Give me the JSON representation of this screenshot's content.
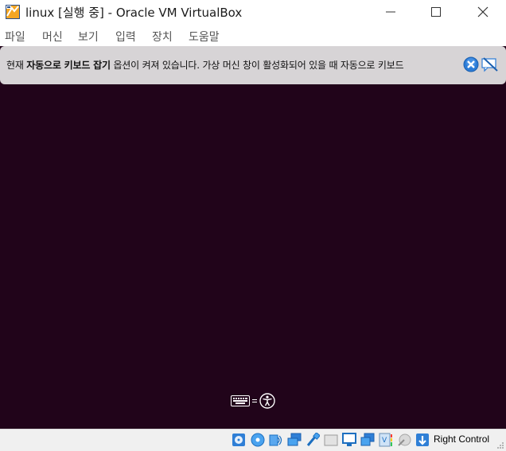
{
  "window": {
    "title": "linux [실행 중] - Oracle VM VirtualBox",
    "app_icon": "virtualbox-icon",
    "controls": [
      "minimize-icon",
      "maximize-icon",
      "close-icon"
    ]
  },
  "menu": {
    "items": [
      "파일",
      "머신",
      "보기",
      "입력",
      "장치",
      "도움말"
    ]
  },
  "notice": {
    "prefix": "현재 ",
    "bold": "자동으로 키보드 잡기",
    "suffix": " 옵션이 켜져 있습니다. 가상 머신 창이 활성화되어 있을 때 자동으로 키보드",
    "icons": [
      "close-notice-icon",
      "mute-notice-icon"
    ]
  },
  "vm": {
    "background": "#21041a",
    "boot_icons": [
      "keyboard-icon",
      "accessibility-icon"
    ]
  },
  "statusbar": {
    "icons": [
      "hard-disk-icon",
      "optical-drive-icon",
      "audio-icon",
      "network-icon",
      "usb-icon",
      "shared-folders-icon",
      "display-icon",
      "recording-icon",
      "cpu-vt-icon",
      "activity-icon",
      "mouse-integration-icon",
      "host-key-icon"
    ],
    "host_key": "Right Control"
  },
  "colors": {
    "accent": "#1a73c9",
    "notice_bg": "#d7d4d6",
    "vm_bg": "#21041a"
  }
}
